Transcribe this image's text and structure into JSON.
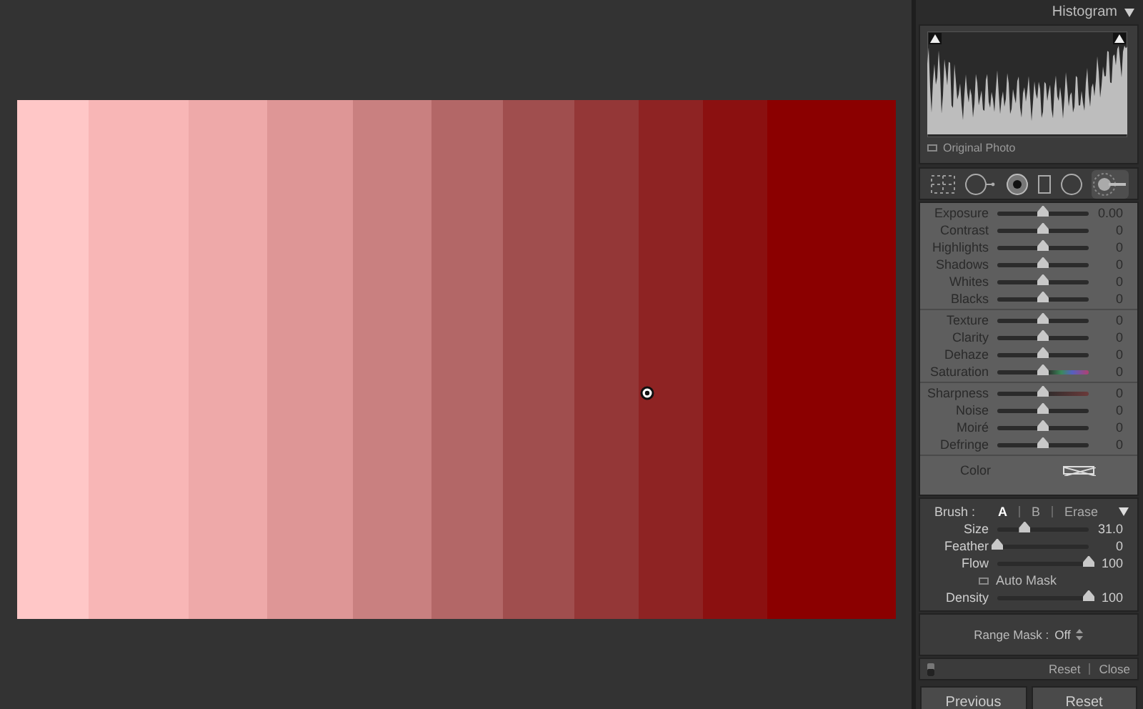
{
  "histogram": {
    "title": "Histogram",
    "original_photo": {
      "label": "Original Photo",
      "checked": false
    }
  },
  "tools": [
    {
      "kind": "grid",
      "selected": false
    },
    {
      "kind": "spot",
      "selected": false
    },
    {
      "kind": "redeye",
      "selected": false
    },
    {
      "kind": "graduated",
      "selected": false
    },
    {
      "kind": "radial",
      "selected": false
    },
    {
      "kind": "brush",
      "selected": true
    }
  ],
  "adjustments": {
    "groups": [
      {
        "sliders": [
          {
            "label": "Exposure",
            "value": "0.00",
            "level": 0.5,
            "kind": "plain"
          },
          {
            "label": "Contrast",
            "value": "0",
            "level": 0.5,
            "kind": "plain"
          },
          {
            "label": "Highlights",
            "value": "0",
            "level": 0.5,
            "kind": "plain"
          },
          {
            "label": "Shadows",
            "value": "0",
            "level": 0.5,
            "kind": "plain"
          },
          {
            "label": "Whites",
            "value": "0",
            "level": 0.5,
            "kind": "plain"
          },
          {
            "label": "Blacks",
            "value": "0",
            "level": 0.5,
            "kind": "plain"
          }
        ]
      },
      {
        "sliders": [
          {
            "label": "Texture",
            "value": "0",
            "level": 0.5,
            "kind": "plain"
          },
          {
            "label": "Clarity",
            "value": "0",
            "level": 0.5,
            "kind": "plain"
          },
          {
            "label": "Dehaze",
            "value": "0",
            "level": 0.5,
            "kind": "plain"
          },
          {
            "label": "Saturation",
            "value": "0",
            "level": 0.5,
            "kind": "hue"
          }
        ]
      },
      {
        "sliders": [
          {
            "label": "Sharpness",
            "value": "0",
            "level": 0.5,
            "kind": "sharp"
          },
          {
            "label": "Noise",
            "value": "0",
            "level": 0.5,
            "kind": "plain"
          },
          {
            "label": "Moiré",
            "value": "0",
            "level": 0.5,
            "kind": "plain"
          },
          {
            "label": "Defringe",
            "value": "0",
            "level": 0.5,
            "kind": "plain"
          }
        ]
      }
    ],
    "color": {
      "label": "Color"
    }
  },
  "brush": {
    "label": "Brush :",
    "tabs": [
      {
        "label": "A",
        "selected": true
      },
      {
        "label": "B",
        "selected": false
      },
      {
        "label": "Erase",
        "selected": false
      }
    ],
    "sliders": [
      {
        "label": "Size",
        "value": "31.0",
        "level": 0.3
      },
      {
        "label": "Feather",
        "value": "0",
        "level": 0
      },
      {
        "label": "Flow",
        "value": "100",
        "level": 1
      }
    ],
    "auto_mask": {
      "label": "Auto Mask",
      "checked": false
    },
    "density": {
      "label": "Density",
      "value": "100",
      "level": 1
    }
  },
  "range_mask": {
    "label": "Range Mask :",
    "value": "Off"
  },
  "footer": {
    "reset": "Reset",
    "close": "Close"
  },
  "buttons": [
    "Previous",
    "Reset"
  ]
}
